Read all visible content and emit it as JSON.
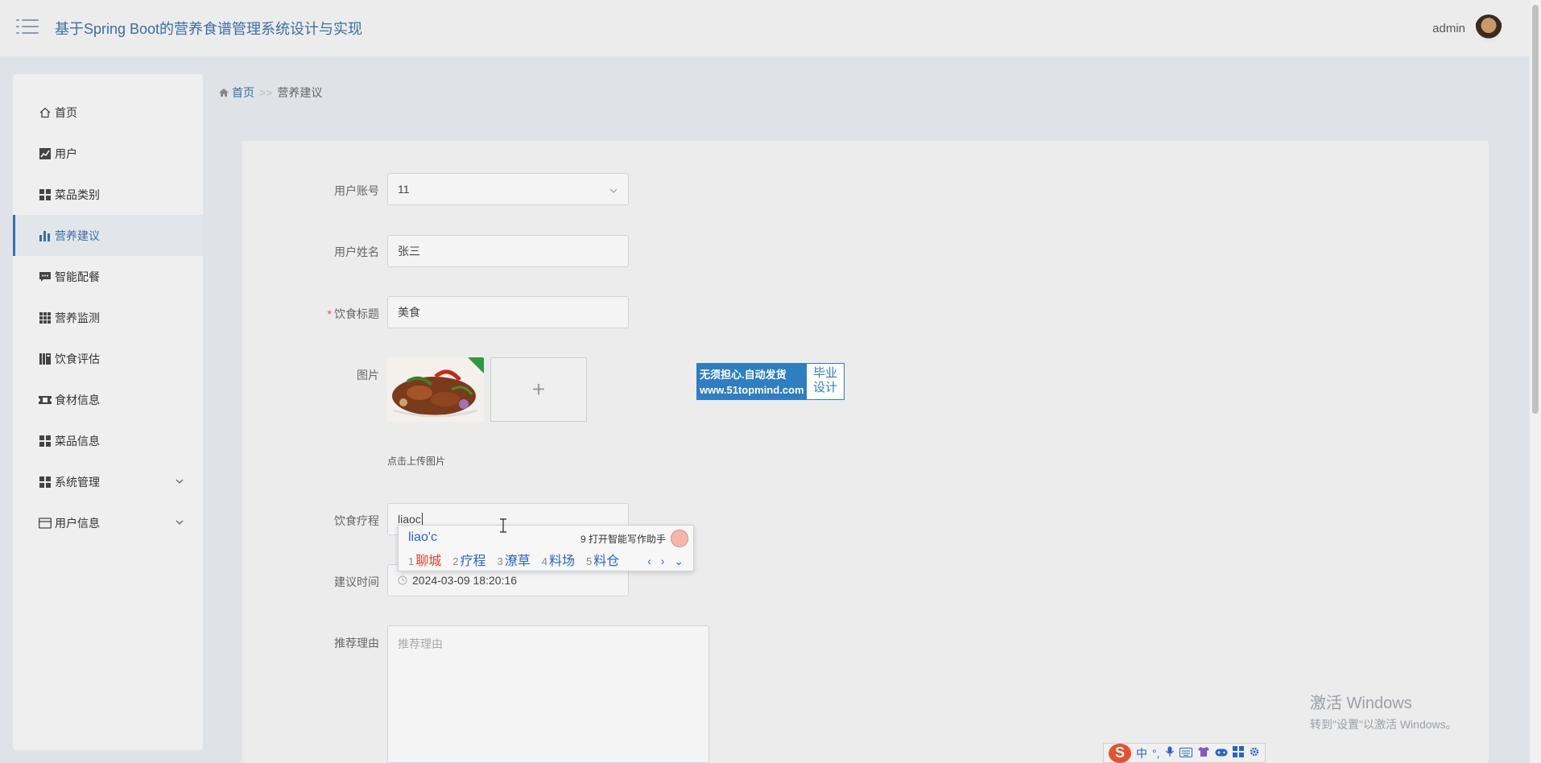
{
  "header": {
    "title": "基于Spring Boot的营养食谱管理系统设计与实现",
    "username": "admin"
  },
  "sidebar": {
    "items": [
      {
        "label": "首页",
        "icon": "home-icon"
      },
      {
        "label": "用户",
        "icon": "line-chart-icon"
      },
      {
        "label": "菜品类别",
        "icon": "grid-icon"
      },
      {
        "label": "营养建议",
        "icon": "bar-chart-icon",
        "active": true
      },
      {
        "label": "智能配餐",
        "icon": "comment-icon"
      },
      {
        "label": "营养监测",
        "icon": "grid-9-icon"
      },
      {
        "label": "饮食评估",
        "icon": "book-icon"
      },
      {
        "label": "食材信息",
        "icon": "ticket-icon"
      },
      {
        "label": "菜品信息",
        "icon": "grid-icon"
      },
      {
        "label": "系统管理",
        "icon": "grid-icon",
        "expandable": true
      },
      {
        "label": "用户信息",
        "icon": "card-icon",
        "expandable": true
      }
    ]
  },
  "breadcrumb": {
    "home": "首页",
    "separator": ">>",
    "current": "营养建议"
  },
  "form": {
    "account": {
      "label": "用户账号",
      "value": "11"
    },
    "name": {
      "label": "用户姓名",
      "value": "张三"
    },
    "diet_title": {
      "label": "饮食标题",
      "value": "美食",
      "required": "*"
    },
    "image": {
      "label": "图片",
      "hint": "点击上传图片",
      "add_symbol": "+"
    },
    "therapy": {
      "label": "饮食疗程",
      "value": "liaoc"
    },
    "time": {
      "label": "建议时间",
      "value": "2024-03-09 18:20:16"
    },
    "reason": {
      "label": "推荐理由",
      "placeholder": "推荐理由"
    }
  },
  "ad": {
    "line1": "无须担心.自动发货",
    "line2": "www.51topmind.com",
    "right": "毕业设计"
  },
  "ime": {
    "composition": "liao'c",
    "assist": "9 打开智能写作助手",
    "candidates": [
      {
        "num": "1",
        "text": "聊城"
      },
      {
        "num": "2",
        "text": "疗程"
      },
      {
        "num": "3",
        "text": "潦草"
      },
      {
        "num": "4",
        "text": "料场"
      },
      {
        "num": "5",
        "text": "料仓"
      }
    ],
    "nav": "‹ › ⌄"
  },
  "windows": {
    "title": "激活 Windows",
    "subtitle": "转到\"设置\"以激活 Windows。"
  },
  "ime_toolbar": {
    "logo": "S",
    "mode": "中"
  },
  "colors": {
    "accent": "#3a6ea5",
    "header_bg": "#ececec",
    "page_bg": "#dfe3e8",
    "required": "#e74c3c"
  }
}
